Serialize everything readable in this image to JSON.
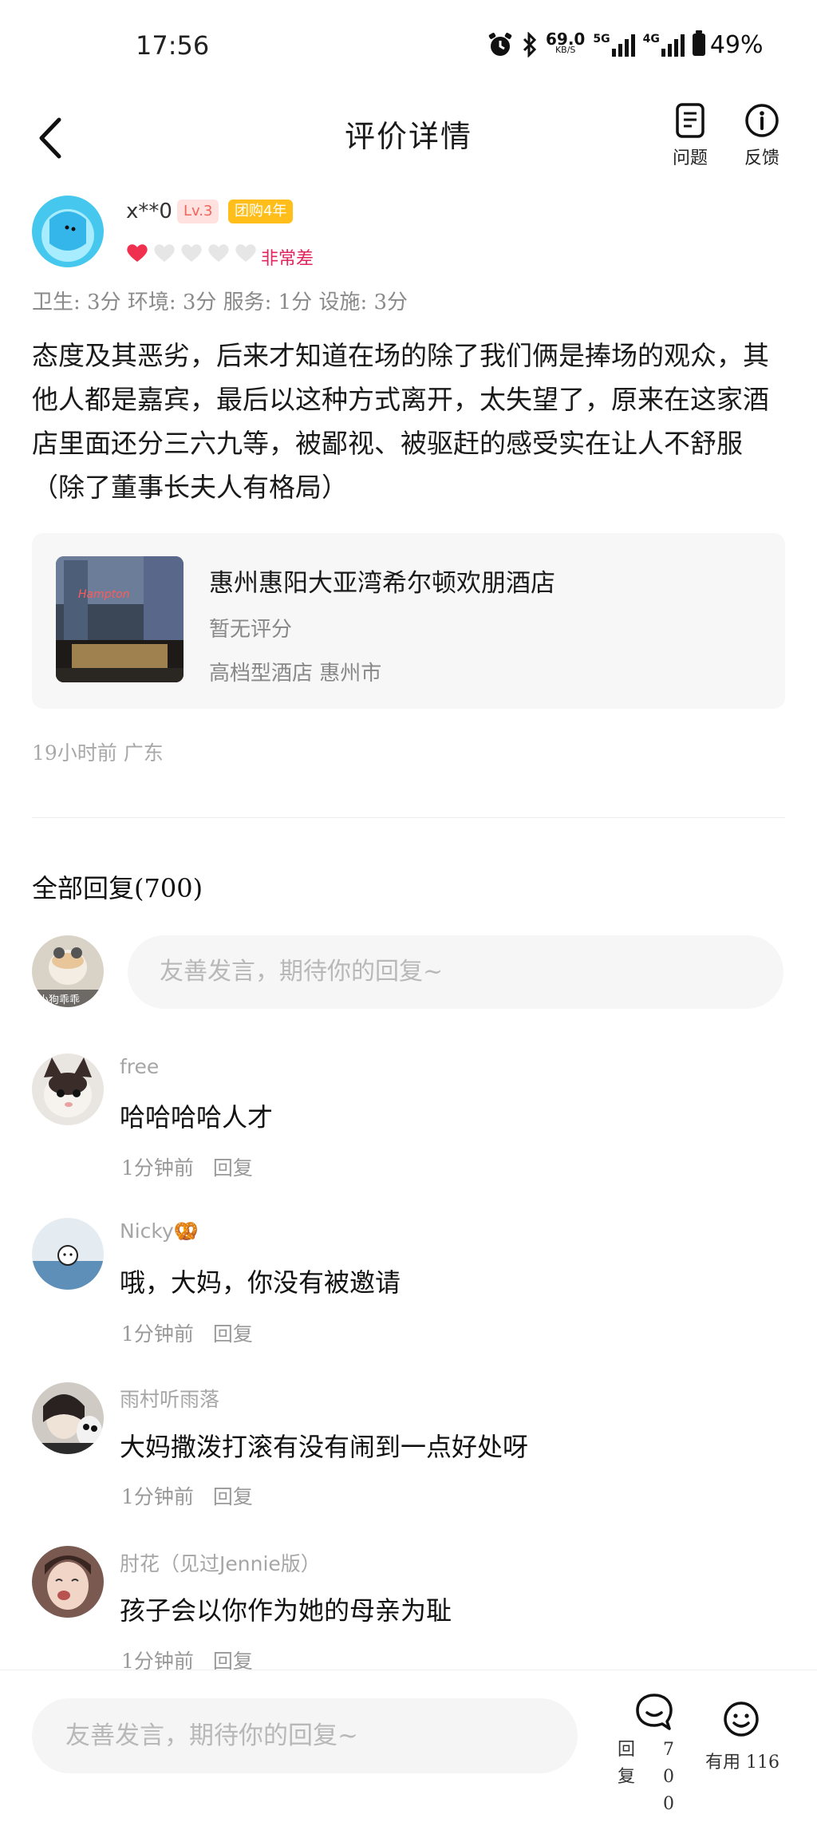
{
  "status_bar": {
    "time": "17:56",
    "net_speed": "69.0",
    "net_unit": "KB/S",
    "net_5g": "5G",
    "net_4g": "4G",
    "battery": "49%"
  },
  "header": {
    "title": "评价详情",
    "question_label": "问题",
    "feedback_label": "反馈"
  },
  "review": {
    "user_name": "x**0",
    "level_badge": "Lv.3",
    "group_badge": "团购4年",
    "hearts_filled": 1,
    "hearts_total": 5,
    "rating_text": "非常差",
    "scores": "卫生: 3分 环境: 3分 服务: 1分 设施: 3分",
    "body": "态度及其恶劣，后来才知道在场的除了我们俩是捧场的观众，其他人都是嘉宾，最后以这种方式离开，太失望了，原来在这家酒店里面还分三六九等，被鄙视、被驱赶的感受实在让人不舒服（除了董事长夫人有格局）",
    "time_location": "19小时前  广东"
  },
  "hotel": {
    "name": "惠州惠阳大亚湾希尔顿欢朋酒店",
    "rating": "暂无评分",
    "category_location": "高档型酒店   惠州市",
    "image_label": "Hampton"
  },
  "replies": {
    "title": "全部回复(700)",
    "input_placeholder": "友善发言，期待你的回复~",
    "my_avatar_caption": "小狗乖乖",
    "comments": [
      {
        "name": "free",
        "text": "哈哈哈哈人才",
        "time": "1分钟前",
        "reply_label": "回复"
      },
      {
        "name": "Nicky🥨",
        "text": "哦，大妈，你没有被邀请",
        "time": "1分钟前",
        "reply_label": "回复"
      },
      {
        "name": "雨村听雨落",
        "text": "大妈撒泼打滚有没有闹到一点好处呀",
        "time": "1分钟前",
        "reply_label": "回复"
      },
      {
        "name": "肘花（见过Jennie版）",
        "text": "孩子会以你作为她的母亲为耻",
        "time": "1分钟前",
        "reply_label": "回复"
      }
    ]
  },
  "bottom_bar": {
    "input_placeholder": "友善发言，期待你的回复~",
    "reply_label": "回复",
    "reply_count": "700",
    "useful_label": "有用 116"
  },
  "colors": {
    "rating_red": "#e0245e",
    "heart_red": "#f0304f",
    "level_bg": "#ffe1df",
    "group_badge_bg": "#ffbe1a"
  }
}
